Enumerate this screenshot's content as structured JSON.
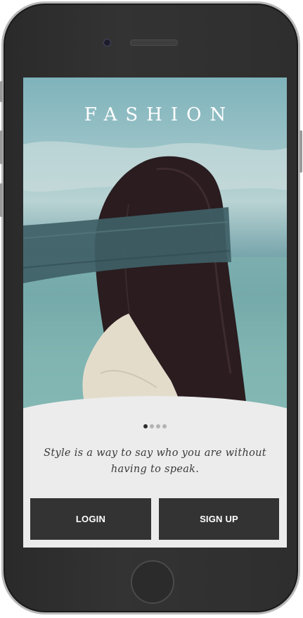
{
  "app": {
    "title": "FASHION"
  },
  "carousel": {
    "page_count": 4,
    "active_index": 0
  },
  "tagline": "Style is a way to say who you are without having to speak.",
  "actions": {
    "login_label": "LOGIN",
    "signup_label": "SIGN UP"
  },
  "colors": {
    "button_bg": "#333333",
    "button_text": "#ffffff",
    "panel_bg": "#ececec",
    "dot_active": "#2d2d2d",
    "dot_inactive": "#b3b3b3"
  }
}
